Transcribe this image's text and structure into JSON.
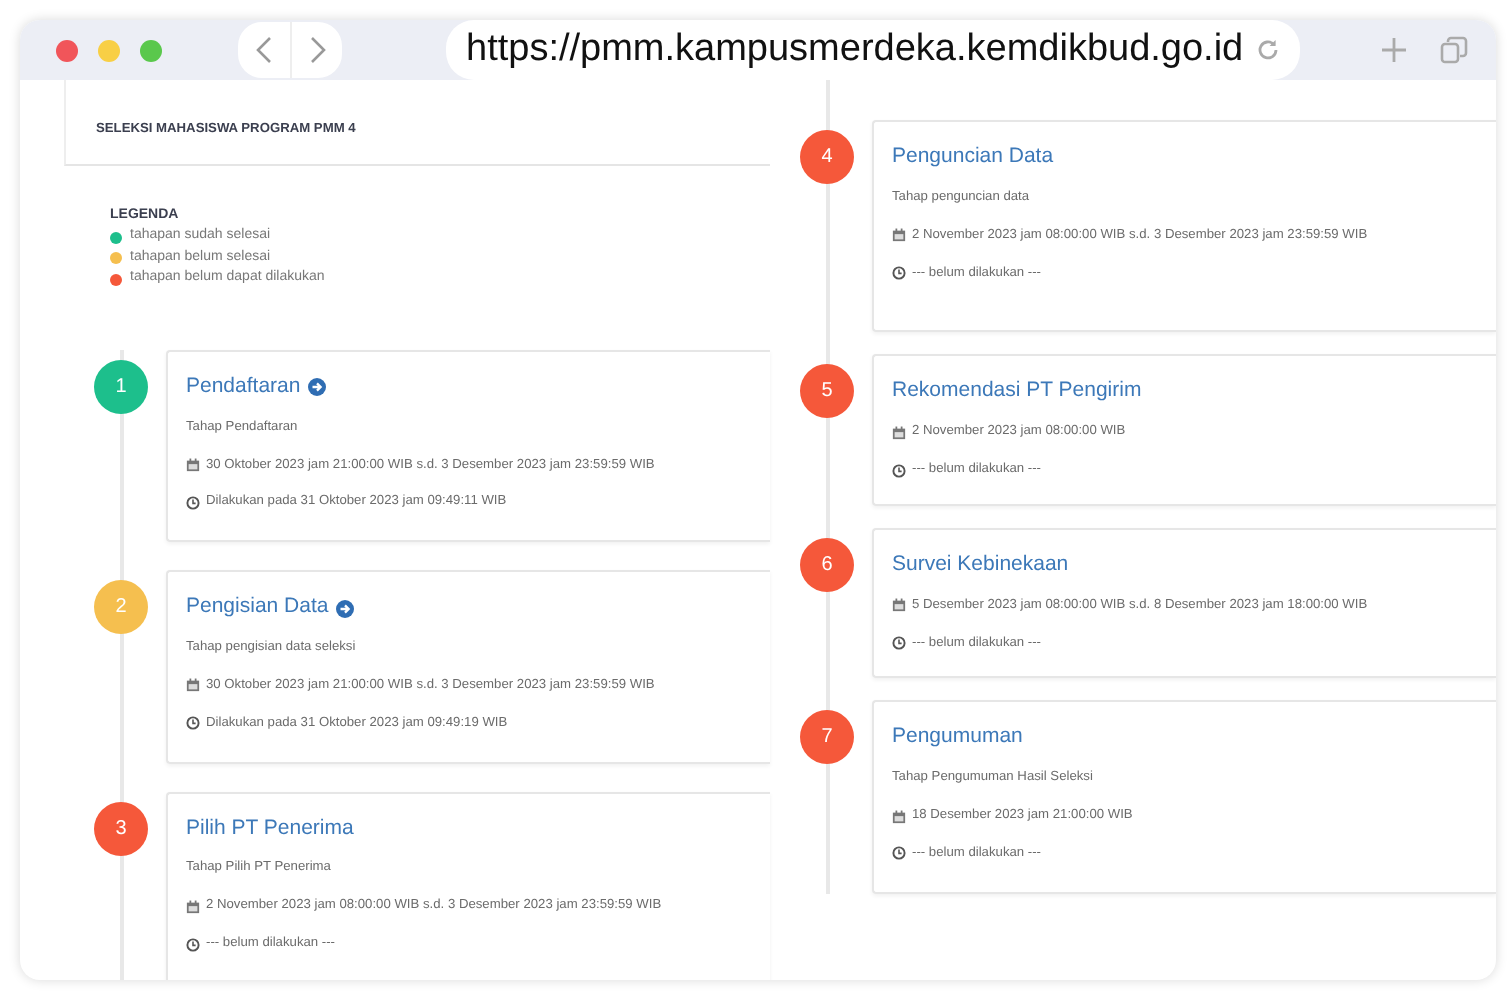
{
  "browser": {
    "url": "https://pmm.kampusmerdeka.kemdikbud.go.id"
  },
  "panel": {
    "title": "SELEKSI MAHASISWA PROGRAM PMM 4"
  },
  "legend": {
    "title": "LEGENDA",
    "items": [
      {
        "label": "tahapan sudah selesai",
        "color": "#1dbf8c"
      },
      {
        "label": "tahapan belum selesai",
        "color": "#f5bf4f"
      },
      {
        "label": "tahapan belum dapat dilakukan",
        "color": "#f5583a"
      }
    ]
  },
  "steps": [
    {
      "number": "1",
      "color": "#1dbf8c",
      "title": "Pendaftaran",
      "link": true,
      "description": "Tahap Pendaftaran",
      "schedule": "30 Oktober 2023 jam 21:00:00 WIB s.d. 3 Desember 2023 jam 23:59:59 WIB",
      "done": "Dilakukan pada 31 Oktober 2023 jam 09:49:11 WIB"
    },
    {
      "number": "2",
      "color": "#f5bf4f",
      "title": "Pengisian Data",
      "link": true,
      "description": "Tahap pengisian data seleksi",
      "schedule": "30 Oktober 2023 jam 21:00:00 WIB s.d. 3 Desember 2023 jam 23:59:59 WIB",
      "done": "Dilakukan pada 31 Oktober 2023 jam 09:49:19 WIB"
    },
    {
      "number": "3",
      "color": "#f5583a",
      "title": "Pilih PT Penerima",
      "link": false,
      "description": "Tahap Pilih PT Penerima",
      "schedule": "2 November 2023 jam 08:00:00 WIB s.d. 3 Desember 2023 jam 23:59:59 WIB",
      "done": "--- belum dilakukan ---"
    },
    {
      "number": "4",
      "color": "#f5583a",
      "title": "Penguncian Data",
      "link": false,
      "description": "Tahap penguncian data",
      "schedule": "2 November 2023 jam 08:00:00 WIB s.d. 3 Desember 2023 jam 23:59:59 WIB",
      "done": "--- belum dilakukan ---"
    },
    {
      "number": "5",
      "color": "#f5583a",
      "title": "Rekomendasi PT Pengirim",
      "link": false,
      "schedule": "2 November 2023 jam 08:00:00 WIB",
      "done": "--- belum dilakukan ---"
    },
    {
      "number": "6",
      "color": "#f5583a",
      "title": "Survei Kebinekaan",
      "link": false,
      "schedule": "5 Desember 2023 jam 08:00:00 WIB s.d. 8 Desember 2023 jam 18:00:00 WIB",
      "done": "--- belum dilakukan ---"
    },
    {
      "number": "7",
      "color": "#f5583a",
      "title": "Pengumuman",
      "link": false,
      "description": "Tahap Pengumuman Hasil Seleksi",
      "schedule": "18 Desember 2023 jam 21:00:00 WIB",
      "done": "--- belum dilakukan ---"
    }
  ]
}
